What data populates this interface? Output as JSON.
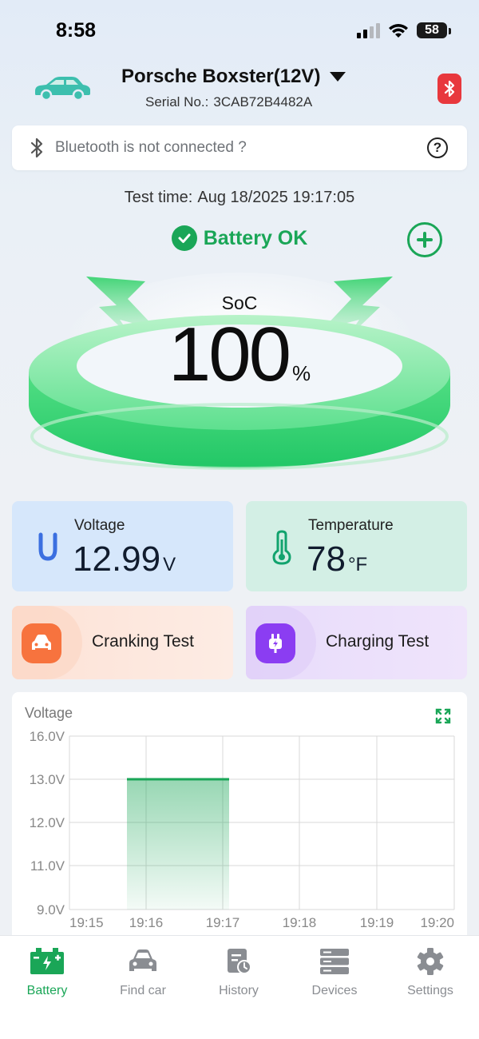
{
  "status_bar": {
    "time": "8:58",
    "battery_level": "58"
  },
  "header": {
    "vehicle_name": "Porsche Boxster(12V)",
    "serial_label": "Serial No.:",
    "serial_value": "3CAB72B4482A"
  },
  "bluetooth_banner": {
    "text": "Bluetooth is not connected ?",
    "help_icon": "?"
  },
  "test_time": {
    "label": "Test time:",
    "value": "Aug 18/2025 19:17:05"
  },
  "battery_status": {
    "label": "Battery OK",
    "color": "#1aa657"
  },
  "soc": {
    "label": "SoC",
    "value": "100",
    "unit": "%",
    "level_fraction": 1.0
  },
  "metrics": {
    "voltage": {
      "title": "Voltage",
      "value": "12.99",
      "unit": "V"
    },
    "temperature": {
      "title": "Temperature",
      "value": "78",
      "unit": "°F"
    }
  },
  "tests": {
    "cranking": {
      "label": "Cranking Test"
    },
    "charging": {
      "label": "Charging Test"
    }
  },
  "chart_data": {
    "type": "area",
    "title": "Voltage",
    "xlabel": "",
    "ylabel": "",
    "y_tick_labels": [
      "16.0V",
      "13.0V",
      "12.0V",
      "11.0V",
      "9.0V"
    ],
    "y_tick_values": [
      16.0,
      13.0,
      12.0,
      11.0,
      9.0
    ],
    "x_tick_labels": [
      "19:15",
      "19:16",
      "19:17",
      "19:18",
      "19:19",
      "19:20"
    ],
    "series": [
      {
        "x_start": "19:15:45",
        "x_end": "19:17:05",
        "value": 13.0
      }
    ],
    "grid": true,
    "color": "#1aa657"
  },
  "tabs": [
    {
      "label": "Battery",
      "icon": "battery-icon",
      "active": true
    },
    {
      "label": "Find car",
      "icon": "car-icon",
      "active": false
    },
    {
      "label": "History",
      "icon": "history-icon",
      "active": false
    },
    {
      "label": "Devices",
      "icon": "devices-icon",
      "active": false
    },
    {
      "label": "Settings",
      "icon": "gear-icon",
      "active": false
    }
  ],
  "colors": {
    "accent_green": "#1aa657",
    "bluetooth_red": "#e8383d",
    "voltage_card": "#d6e7fb",
    "temperature_card": "#d3efe5",
    "cranking_icon": "#f7733e",
    "charging_icon": "#8b3df2"
  }
}
